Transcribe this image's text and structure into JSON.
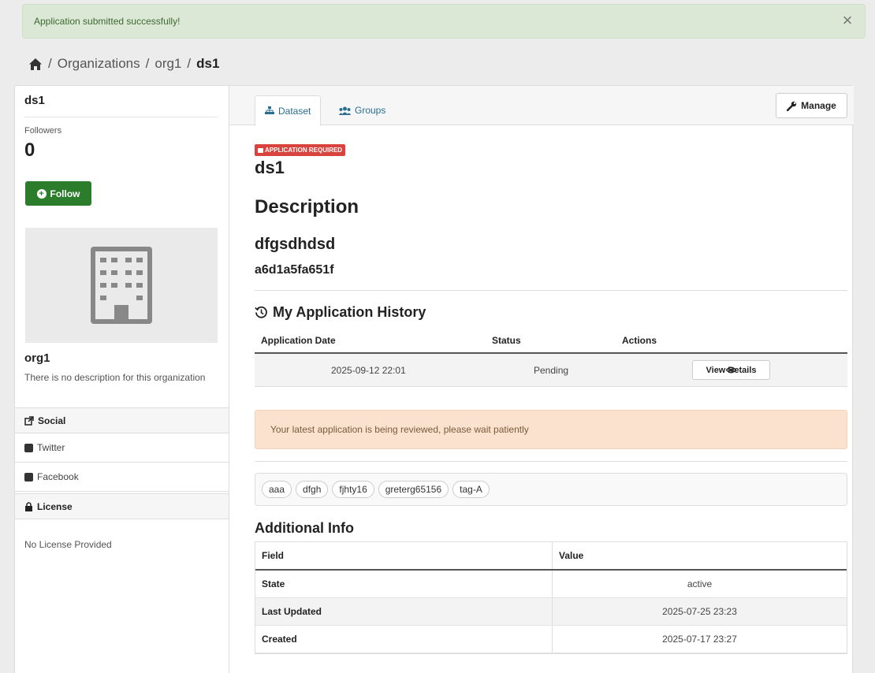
{
  "alert": {
    "message": "Application submitted successfully!",
    "close_icon": "close-icon"
  },
  "breadcrumb": {
    "items": [
      "Organizations",
      "org1",
      "ds1"
    ],
    "separator": "/"
  },
  "sidebar": {
    "title": "ds1",
    "followers_label": "Followers",
    "followers_count": "0",
    "follow_label": "Follow",
    "org_name": "org1",
    "org_description": "There is no description for this organization",
    "social_heading": "Social",
    "social_links": [
      "Twitter",
      "Facebook"
    ],
    "license_heading": "License",
    "license_text": "No License Provided"
  },
  "tabs": [
    {
      "label": "Dataset",
      "icon": "sitemap-icon",
      "active": true
    },
    {
      "label": "Groups",
      "icon": "users-icon",
      "active": false
    }
  ],
  "manage_label": "Manage",
  "dataset": {
    "badge": "APPLICATION REQUIRED",
    "title": "ds1",
    "description_heading": "Description",
    "description_text": "dfgsdhdsd",
    "description_hash": "a6d1a5fa651f"
  },
  "history": {
    "heading": "My Application History",
    "columns": [
      "Application Date",
      "Status",
      "Actions"
    ],
    "rows": [
      {
        "date": "2025-09-12 22:01",
        "status": "Pending",
        "action": "View Details"
      }
    ]
  },
  "review_notice": "Your latest application is being reviewed, please wait patiently",
  "tags": [
    "aaa",
    "dfgh",
    "fjhty16",
    "greterg65156",
    "tag-A"
  ],
  "additional_info": {
    "heading": "Additional Info",
    "columns": [
      "Field",
      "Value"
    ],
    "rows": [
      {
        "field": "State",
        "value": "active"
      },
      {
        "field": "Last Updated",
        "value": "2025-07-25 23:23"
      },
      {
        "field": "Created",
        "value": "2025-07-17 23:27"
      }
    ]
  },
  "colors": {
    "success": "#dce8d6",
    "follow_green": "#2b7d2b",
    "badge_red": "#d9433e",
    "warning": "#fbe2cf",
    "link": "#2a6f8f"
  }
}
